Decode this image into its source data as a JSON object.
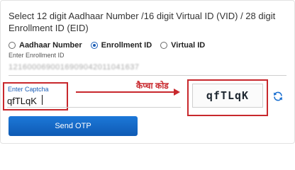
{
  "instruction": "Select 12 digit Aadhaar Number /16 digit Virtual ID (VID) / 28 digit Enrollment ID (EID)",
  "id_type_options": [
    {
      "label": "Aadhaar Number",
      "selected": false
    },
    {
      "label": "Enrollment ID",
      "selected": true
    },
    {
      "label": "Virtual ID",
      "selected": false
    }
  ],
  "enrollment": {
    "label": "Enter Enrollment ID",
    "value": "1216000690016909042011041637"
  },
  "captcha": {
    "label": "Enter Captcha",
    "value": "qfTLqK",
    "image_text": "qfTLqK",
    "annotation": "कैप्चा कोड"
  },
  "icons": {
    "refresh": "refresh-icon",
    "arrow": "arrow-right-icon"
  },
  "send_otp_label": "Send OTP",
  "colors": {
    "primary": "#1a6fd0",
    "annotation": "#c8282d"
  }
}
